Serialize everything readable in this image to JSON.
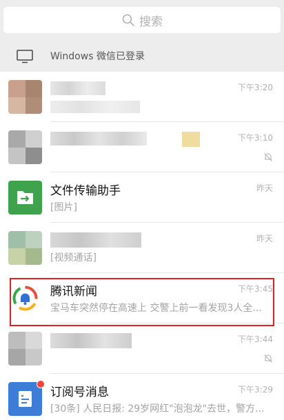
{
  "search": {
    "placeholder": "搜索"
  },
  "login_bar": {
    "text": "Windows 微信已登录",
    "icon": "monitor-icon"
  },
  "chats": [
    {
      "title": "",
      "subtitle": "",
      "time": "下午3:20",
      "muted": false
    },
    {
      "title": "",
      "subtitle": "",
      "time": "下午3:10",
      "muted": true
    },
    {
      "title": "文件传输助手",
      "subtitle": "[图片]",
      "time": "昨天",
      "muted": false,
      "avatar_icon": "folder-transfer-icon",
      "avatar_color": "#3fa34d"
    },
    {
      "title": "",
      "subtitle": "[视频通话]",
      "time": "昨天",
      "muted": false
    },
    {
      "title": "腾讯新闻",
      "subtitle": "宝马车突然停在高速上 交警上前一看发现3人全...",
      "time": "下午3:45",
      "muted": false,
      "avatar_icon": "tencent-news-icon"
    },
    {
      "title": "",
      "subtitle": "",
      "time": "下午3:44",
      "muted": true
    },
    {
      "title": "订阅号消息",
      "subtitle": "[30条] 人民日报: 29岁网红\"泡泡龙\"去世，警方...",
      "time": "下午3:29",
      "muted": false,
      "avatar_icon": "subscription-doc-icon",
      "avatar_color": "#3d7dd8",
      "unread_dot": true
    }
  ],
  "colors": {
    "background": "#ededed",
    "highlight": "#e02020",
    "badge": "#f44336"
  }
}
